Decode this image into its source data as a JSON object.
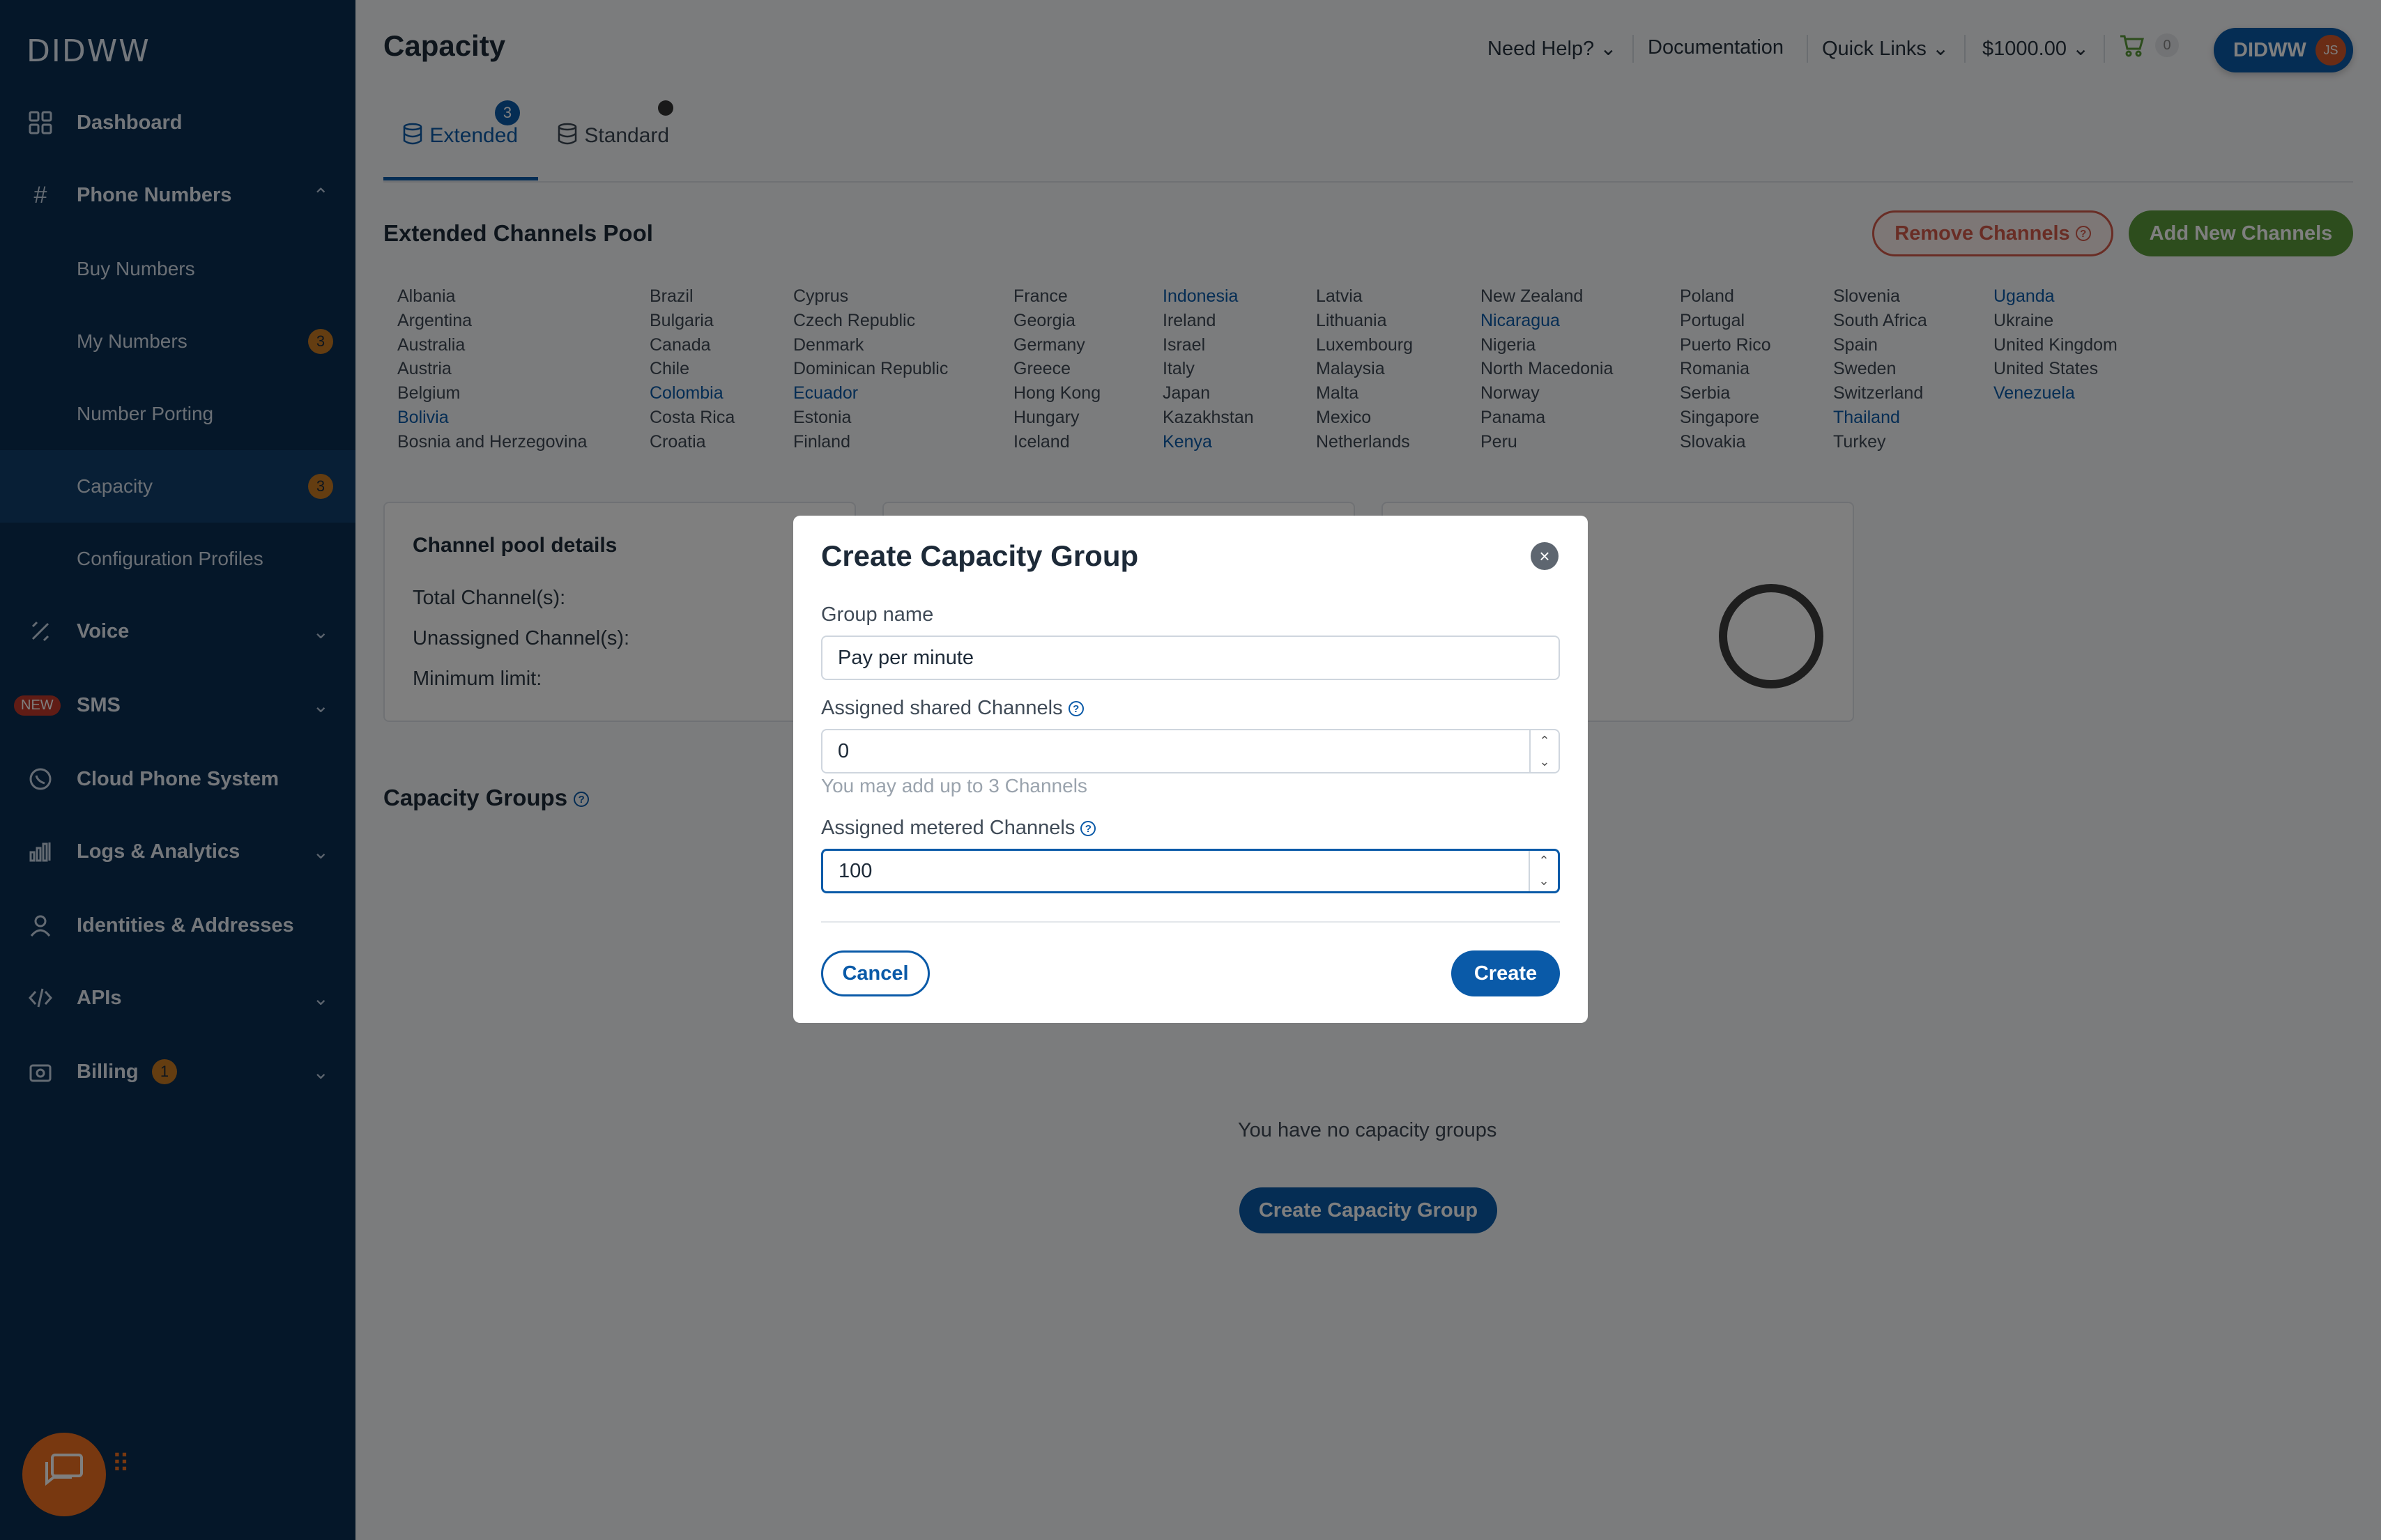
{
  "brand": {
    "logo_text": "DIDWW",
    "accent": "#0a5aa8",
    "sidebar_bg": "#0b2e52"
  },
  "sidebar": {
    "dashboard": "Dashboard",
    "phone_numbers": "Phone Numbers",
    "buy_numbers": "Buy Numbers",
    "my_numbers": "My Numbers",
    "my_numbers_badge": "3",
    "number_porting": "Number Porting",
    "capacity": "Capacity",
    "capacity_badge": "3",
    "configuration_profiles": "Configuration Profiles",
    "voice": "Voice",
    "sms_new": "NEW",
    "sms": "SMS",
    "cloud_phone_system": "Cloud Phone System",
    "logs_analytics": "Logs & Analytics",
    "identities_addresses": "Identities & Addresses",
    "apis": "APIs",
    "billing": "Billing",
    "billing_badge": "1"
  },
  "header": {
    "title": "Capacity",
    "need_help": "Need Help?",
    "documentation": "Documentation",
    "quick_links": "Quick Links",
    "balance": "$1000.00",
    "cart_count": "0",
    "account_name": "DIDWW",
    "avatar_initials": "JS"
  },
  "tabs": {
    "extended": "Extended",
    "extended_badge": "3",
    "standard": "Standard"
  },
  "pool": {
    "title": "Extended Channels Pool",
    "remove_button": "Remove Channels",
    "add_button": "Add New Channels",
    "countries": [
      [
        {
          "n": "Albania"
        },
        {
          "n": "Argentina"
        },
        {
          "n": "Australia"
        },
        {
          "n": "Austria"
        },
        {
          "n": "Belgium"
        },
        {
          "n": "Bolivia",
          "link": true
        },
        {
          "n": "Bosnia and Herzegovina"
        }
      ],
      [
        {
          "n": "Brazil"
        },
        {
          "n": "Bulgaria"
        },
        {
          "n": "Canada"
        },
        {
          "n": "Chile"
        },
        {
          "n": "Colombia",
          "link": true
        },
        {
          "n": "Costa Rica"
        },
        {
          "n": "Croatia"
        }
      ],
      [
        {
          "n": "Cyprus"
        },
        {
          "n": "Czech Republic"
        },
        {
          "n": "Denmark"
        },
        {
          "n": "Dominican Republic"
        },
        {
          "n": "Ecuador",
          "link": true
        },
        {
          "n": "Estonia"
        },
        {
          "n": "Finland"
        }
      ],
      [
        {
          "n": "France"
        },
        {
          "n": "Georgia"
        },
        {
          "n": "Germany"
        },
        {
          "n": "Greece"
        },
        {
          "n": "Hong Kong"
        },
        {
          "n": "Hungary"
        },
        {
          "n": "Iceland"
        }
      ],
      [
        {
          "n": "Indonesia",
          "link": true
        },
        {
          "n": "Ireland"
        },
        {
          "n": "Israel"
        },
        {
          "n": "Italy"
        },
        {
          "n": "Japan"
        },
        {
          "n": "Kazakhstan"
        },
        {
          "n": "Kenya",
          "link": true
        }
      ],
      [
        {
          "n": "Latvia"
        },
        {
          "n": "Lithuania"
        },
        {
          "n": "Luxembourg"
        },
        {
          "n": "Malaysia"
        },
        {
          "n": "Malta"
        },
        {
          "n": "Mexico"
        },
        {
          "n": "Netherlands"
        }
      ],
      [
        {
          "n": "New Zealand"
        },
        {
          "n": "Nicaragua",
          "link": true
        },
        {
          "n": "Nigeria"
        },
        {
          "n": "North Macedonia"
        },
        {
          "n": "Norway"
        },
        {
          "n": "Panama"
        },
        {
          "n": "Peru"
        }
      ],
      [
        {
          "n": "Poland"
        },
        {
          "n": "Portugal"
        },
        {
          "n": "Puerto Rico"
        },
        {
          "n": "Romania"
        },
        {
          "n": "Serbia"
        },
        {
          "n": "Singapore"
        },
        {
          "n": "Slovakia"
        }
      ],
      [
        {
          "n": "Slovenia"
        },
        {
          "n": "South Africa"
        },
        {
          "n": "Spain"
        },
        {
          "n": "Sweden"
        },
        {
          "n": "Switzerland"
        },
        {
          "n": "Thailand",
          "link": true
        },
        {
          "n": "Turkey"
        }
      ],
      [
        {
          "n": "Uganda",
          "link": true
        },
        {
          "n": "Ukraine"
        },
        {
          "n": "United Kingdom"
        },
        {
          "n": "United States"
        },
        {
          "n": "Venezuela",
          "link": true
        }
      ]
    ]
  },
  "details": {
    "title": "Channel pool details",
    "total": "Total Channel(s):",
    "unassigned": "Unassigned Channel(s):",
    "minimum": "Minimum limit:"
  },
  "groups": {
    "title": "Capacity Groups",
    "empty": "You have no capacity groups",
    "create_button": "Create Capacity Group"
  },
  "modal": {
    "title": "Create Capacity Group",
    "group_name_label": "Group name",
    "group_name_value": "Pay per minute",
    "shared_label": "Assigned shared Channels",
    "shared_value": "0",
    "shared_hint": "You may add up to 3 Channels",
    "metered_label": "Assigned metered Channels",
    "metered_value": "100",
    "cancel": "Cancel",
    "create": "Create"
  }
}
